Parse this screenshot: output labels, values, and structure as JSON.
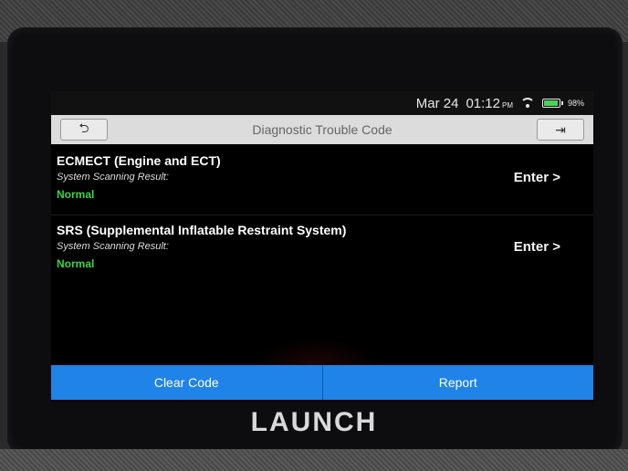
{
  "statusbar": {
    "date": "Mar 24",
    "time": "01:12",
    "ampm": "PM",
    "battery": "98%",
    "battery_level": 0.98
  },
  "titlebar": {
    "title": "Diagnostic Trouble Code"
  },
  "systems": [
    {
      "name": "ECMECT (Engine and ECT)",
      "result_label": "System Scanning Result:",
      "status": "Normal",
      "action": "Enter >"
    },
    {
      "name": "SRS (Supplemental Inflatable Restraint System)",
      "result_label": "System Scanning Result:",
      "status": "Normal",
      "action": "Enter >"
    }
  ],
  "buttons": {
    "clear_code": "Clear Code",
    "report": "Report"
  },
  "device": {
    "brand": "LAUNCH"
  },
  "colors": {
    "accent": "#1f83e8",
    "normal_status": "#3fd34a"
  }
}
